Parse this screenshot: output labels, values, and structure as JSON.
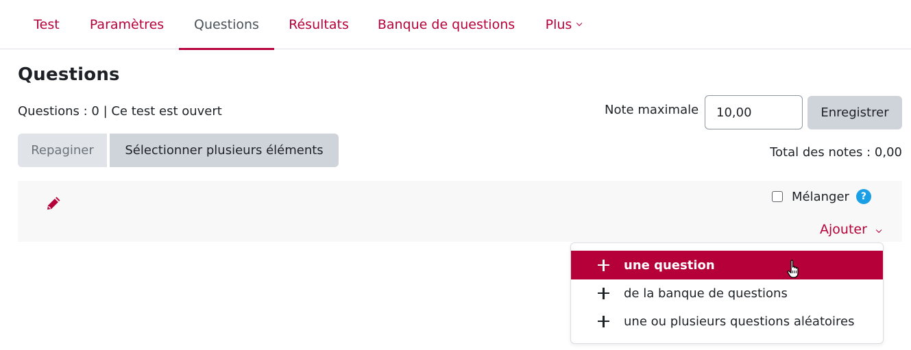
{
  "tabs": [
    {
      "label": "Test",
      "active": false
    },
    {
      "label": "Paramètres",
      "active": false
    },
    {
      "label": "Questions",
      "active": true
    },
    {
      "label": "Résultats",
      "active": false
    },
    {
      "label": "Banque de questions",
      "active": false
    },
    {
      "label": "Plus",
      "active": false,
      "has_dropdown": true
    }
  ],
  "page": {
    "title": "Questions",
    "info": "Questions : 0 | Ce test est ouvert",
    "max_grade_label": "Note maximale",
    "max_grade_value": "10,00",
    "save_label": "Enregistrer",
    "repaginate_label": "Repaginer",
    "select_multiple_label": "Sélectionner plusieurs éléments",
    "total_grades": "Total des notes : 0,00"
  },
  "section": {
    "edit_icon": "pencil-icon",
    "shuffle_label": "Mélanger",
    "shuffle_checked": false,
    "help_icon": "question-mark-icon",
    "help_symbol": "?",
    "add_label": "Ajouter"
  },
  "add_menu": {
    "items": [
      {
        "label": "une question",
        "icon": "plus-icon",
        "highlighted": true
      },
      {
        "label": "de la banque de questions",
        "icon": "plus-icon",
        "highlighted": false
      },
      {
        "label": "une ou plusieurs questions aléatoires",
        "icon": "plus-icon",
        "highlighted": false
      }
    ]
  },
  "colors": {
    "brand": "#b6003a",
    "button_bg": "#ced4da",
    "help_blue": "#1a9fe6"
  }
}
